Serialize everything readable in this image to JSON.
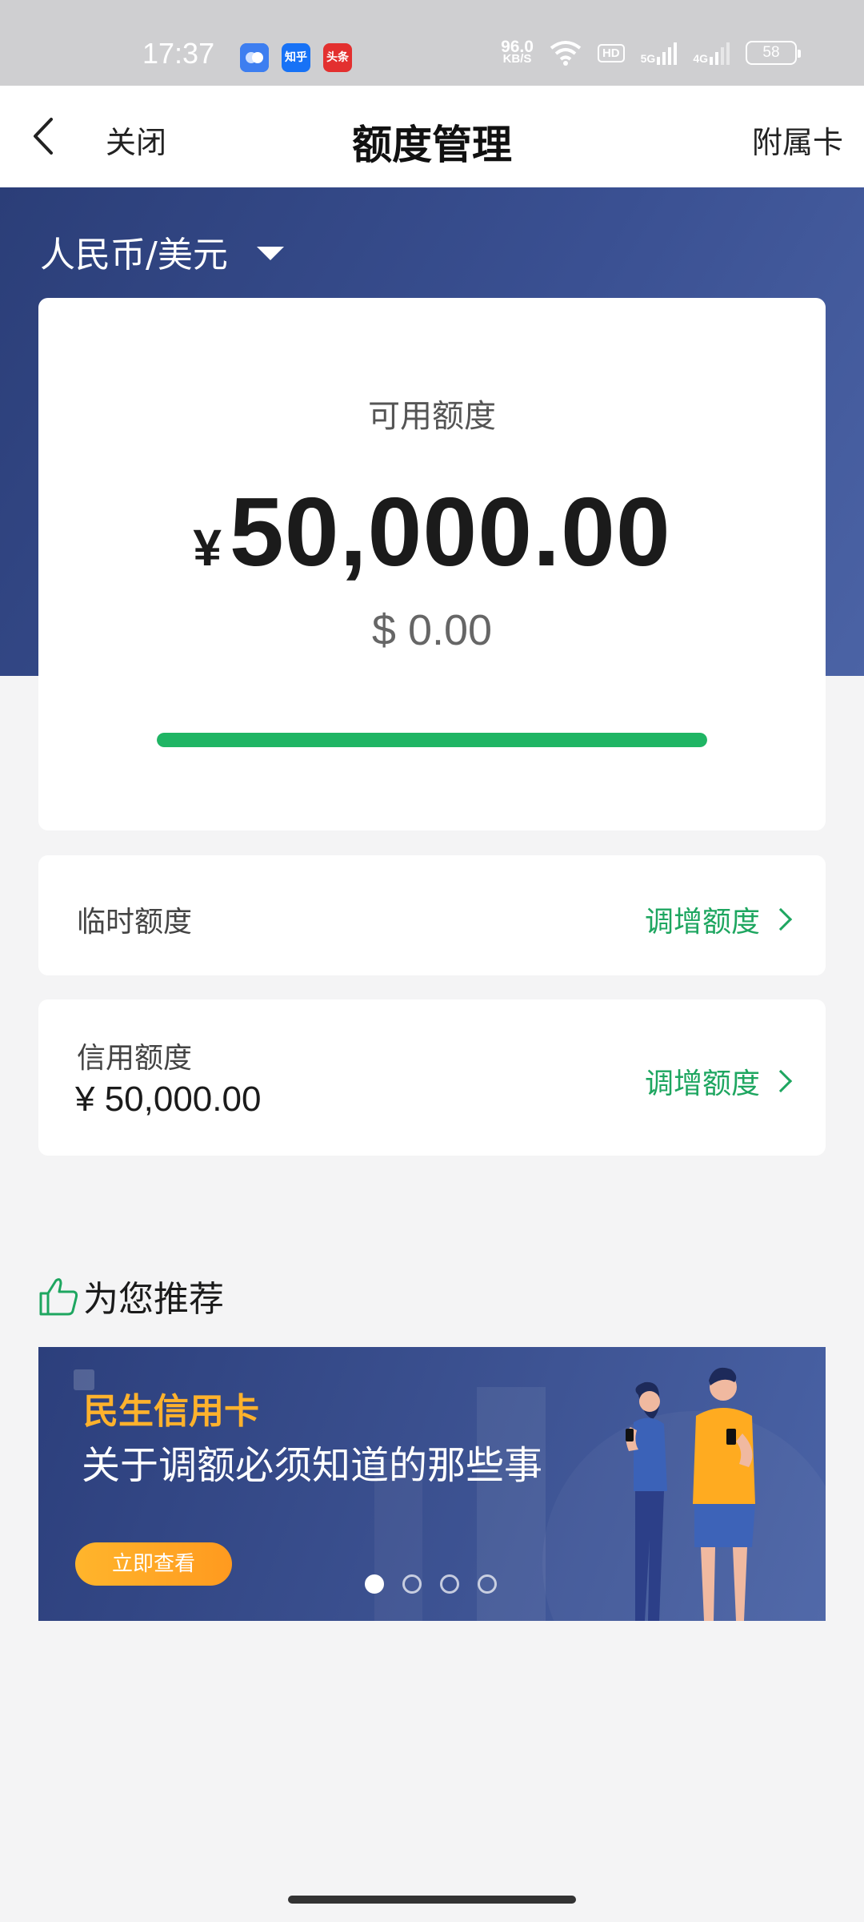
{
  "status_bar": {
    "time": "17:37",
    "apps": [
      {
        "icon": "messages-app-icon",
        "label": ""
      },
      {
        "icon": "zhihu-app-icon",
        "label": "知乎"
      },
      {
        "icon": "toutiao-app-icon",
        "label": "头条"
      }
    ],
    "net_speed_value": "96.0",
    "net_speed_unit": "KB/S",
    "hd_label": "HD",
    "signal_1": "5G",
    "signal_2": "4G",
    "battery": "58"
  },
  "nav": {
    "close_label": "关闭",
    "title": "额度管理",
    "right_label": "附属卡"
  },
  "currency_selector": {
    "label": "人民币/美元"
  },
  "available": {
    "label": "可用额度",
    "currency_symbol": "¥",
    "amount": "50,000.00",
    "usd_amount": "$ 0.00",
    "progress_fraction": 1.0
  },
  "temp_limit": {
    "label": "临时额度",
    "link": "调增额度"
  },
  "credit_limit": {
    "label": "信用额度",
    "value": "¥ 50,000.00",
    "link": "调增额度"
  },
  "recommend": {
    "title": "为您推荐",
    "banner": {
      "brand": "民生信用卡",
      "headline": "关于调额必须知道的那些事",
      "button": "立即查看",
      "dots_count": 4,
      "active_dot": 0
    }
  },
  "colors": {
    "accent_green": "#1ea660",
    "progress_green": "#1fb564",
    "hero_blue": "#34498a",
    "banner_orange": "#ffb22c"
  }
}
